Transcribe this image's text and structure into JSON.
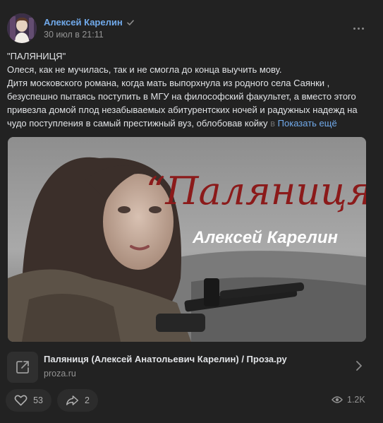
{
  "post": {
    "author": "Алексей Карелин",
    "date": "30 июл в 21:11",
    "text_lines": [
      "\"ПАЛЯНИЦЯ\"",
      "Олеся, как не мучилась, так и не смогла до конца выучить мову.",
      "Дитя московского романа, когда мать выпорхнула из родного села Саянки ,",
      "безуспешно пытаясь поступить в МГУ на философский факультет, а вместо этого",
      "привезла домой плод незабываемых абитурентских ночей и радужных надежд на",
      "чудо поступления в самый престижный вуз, облобовав койку"
    ],
    "text_fade": "в",
    "show_more": "Показать ещё",
    "image": {
      "title_text": "“Паляниця”",
      "author_text": "Алексей Карелин"
    },
    "link": {
      "title": "Паляниця (Алексей Анатольевич Карелин) / Проза.ру",
      "domain": "proza.ru"
    },
    "likes": "53",
    "shares": "2",
    "views": "1.2K"
  },
  "colors": {
    "background": "#222222",
    "link_accent": "#71aaeb",
    "muted": "#939393"
  },
  "icons": [
    "verified-icon",
    "more-icon",
    "external-link-icon",
    "chevron-right-icon",
    "heart-icon",
    "share-icon",
    "eye-icon"
  ]
}
